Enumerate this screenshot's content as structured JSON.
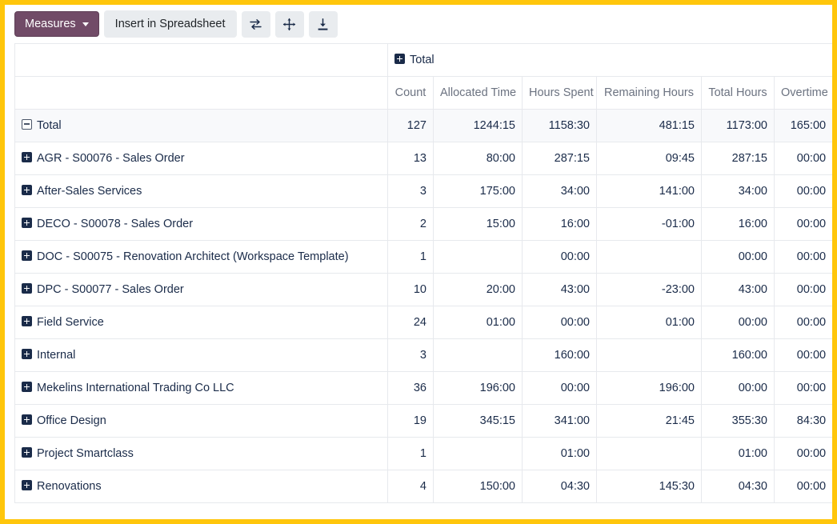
{
  "toolbar": {
    "measures_label": "Measures",
    "insert_label": "Insert in Spreadsheet",
    "flip_axis_title": "Flip axis",
    "expand_all_title": "Expand all",
    "download_title": "Download xlsx"
  },
  "pivot": {
    "column_group_label": "Total",
    "row_total_label": "Total",
    "measures": [
      "Count",
      "Allocated Time",
      "Hours Spent",
      "Remaining Hours",
      "Total Hours",
      "Overtime"
    ],
    "total_row": {
      "label": "Total",
      "values": [
        "127",
        "1244:15",
        "1158:30",
        "481:15",
        "1173:00",
        "165:00"
      ]
    },
    "rows": [
      {
        "label": "AGR - S00076 - Sales Order",
        "values": [
          "13",
          "80:00",
          "287:15",
          "09:45",
          "287:15",
          "00:00"
        ]
      },
      {
        "label": "After-Sales Services",
        "values": [
          "3",
          "175:00",
          "34:00",
          "141:00",
          "34:00",
          "00:00"
        ]
      },
      {
        "label": "DECO - S00078 - Sales Order",
        "values": [
          "2",
          "15:00",
          "16:00",
          "-01:00",
          "16:00",
          "00:00"
        ]
      },
      {
        "label": "DOC - S00075 - Renovation Architect (Workspace Template)",
        "values": [
          "1",
          "",
          "00:00",
          "",
          "00:00",
          "00:00"
        ]
      },
      {
        "label": "DPC - S00077 - Sales Order",
        "values": [
          "10",
          "20:00",
          "43:00",
          "-23:00",
          "43:00",
          "00:00"
        ]
      },
      {
        "label": "Field Service",
        "values": [
          "24",
          "01:00",
          "00:00",
          "01:00",
          "00:00",
          "00:00"
        ]
      },
      {
        "label": "Internal",
        "values": [
          "3",
          "",
          "160:00",
          "",
          "160:00",
          "00:00"
        ]
      },
      {
        "label": "Mekelins International Trading Co LLC",
        "values": [
          "36",
          "196:00",
          "00:00",
          "196:00",
          "00:00",
          "00:00"
        ]
      },
      {
        "label": "Office Design",
        "values": [
          "19",
          "345:15",
          "341:00",
          "21:45",
          "355:30",
          "84:30"
        ]
      },
      {
        "label": "Project Smartclass",
        "values": [
          "1",
          "",
          "01:00",
          "",
          "01:00",
          "00:00"
        ]
      },
      {
        "label": "Renovations",
        "values": [
          "4",
          "150:00",
          "04:30",
          "145:30",
          "04:30",
          "00:00"
        ]
      }
    ]
  },
  "colors": {
    "accent": "#714B67",
    "border_highlight": "#FFC60B",
    "grid_line": "#e7e9ed",
    "text": "#1a2b49",
    "muted_text": "#6b7280"
  }
}
